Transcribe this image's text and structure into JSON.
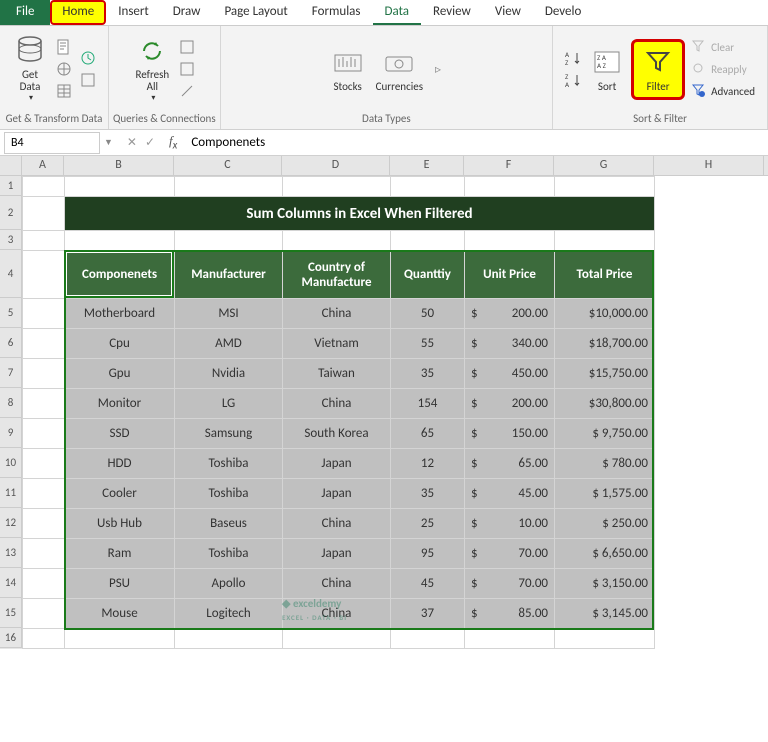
{
  "tabs": {
    "file": "File",
    "home": "Home",
    "insert": "Insert",
    "draw": "Draw",
    "pageLayout": "Page Layout",
    "formulas": "Formulas",
    "data": "Data",
    "review": "Review",
    "view": "View",
    "develop": "Develo"
  },
  "ribbon": {
    "getData": "Get\nData",
    "groupGetTransform": "Get & Transform Data",
    "refreshAll": "Refresh\nAll",
    "groupQueries": "Queries & Connections",
    "stocks": "Stocks",
    "currencies": "Currencies",
    "groupDataTypes": "Data Types",
    "sort": "Sort",
    "filter": "Filter",
    "clear": "Clear",
    "reapply": "Reapply",
    "advanced": "Advanced",
    "groupSortFilter": "Sort & Filter"
  },
  "nameBox": "B4",
  "formulaValue": "Componenets",
  "columns": [
    "A",
    "B",
    "C",
    "D",
    "E",
    "F",
    "G",
    "H"
  ],
  "rowNumbers": [
    "1",
    "2",
    "3",
    "4",
    "5",
    "6",
    "7",
    "8",
    "9",
    "10",
    "11",
    "12",
    "13",
    "14",
    "15",
    "16"
  ],
  "titleRow": "Sum  Columns in Excel When Filtered",
  "headers": {
    "b": "Componenets",
    "c": "Manufacturer",
    "d": "Country of Manufacture",
    "e": "Quanttiy",
    "f": "Unit Price",
    "g": "Total Price"
  },
  "rows": [
    {
      "b": "Motherboard",
      "c": "MSI",
      "d": "China",
      "e": "50",
      "f": "200.00",
      "g": "$10,000.00"
    },
    {
      "b": "Cpu",
      "c": "AMD",
      "d": "Vietnam",
      "e": "55",
      "f": "340.00",
      "g": "$18,700.00"
    },
    {
      "b": "Gpu",
      "c": "Nvidia",
      "d": "Taiwan",
      "e": "35",
      "f": "450.00",
      "g": "$15,750.00"
    },
    {
      "b": "Monitor",
      "c": "LG",
      "d": "China",
      "e": "154",
      "f": "200.00",
      "g": "$30,800.00"
    },
    {
      "b": "SSD",
      "c": "Samsung",
      "d": "South Korea",
      "e": "65",
      "f": "150.00",
      "g": "$  9,750.00"
    },
    {
      "b": "HDD",
      "c": "Toshiba",
      "d": "Japan",
      "e": "12",
      "f": "65.00",
      "g": "$     780.00"
    },
    {
      "b": "Cooler",
      "c": "Toshiba",
      "d": "Japan",
      "e": "35",
      "f": "45.00",
      "g": "$  1,575.00"
    },
    {
      "b": "Usb Hub",
      "c": "Baseus",
      "d": "China",
      "e": "25",
      "f": "10.00",
      "g": "$     250.00"
    },
    {
      "b": "Ram",
      "c": "Toshiba",
      "d": "Japan",
      "e": "95",
      "f": "70.00",
      "g": "$  6,650.00"
    },
    {
      "b": "PSU",
      "c": "Apollo",
      "d": "China",
      "e": "45",
      "f": "70.00",
      "g": "$  3,150.00"
    },
    {
      "b": "Mouse",
      "c": "Logitech",
      "d": "China",
      "e": "37",
      "f": "85.00",
      "g": "$  3,145.00"
    }
  ],
  "rowHeights": {
    "r1": 20,
    "r2": 34,
    "r3": 20,
    "r4": 48,
    "data": 30,
    "r16": 20
  },
  "watermark": {
    "main": "exceldemy",
    "sub": "EXCEL · DATA · BI"
  }
}
